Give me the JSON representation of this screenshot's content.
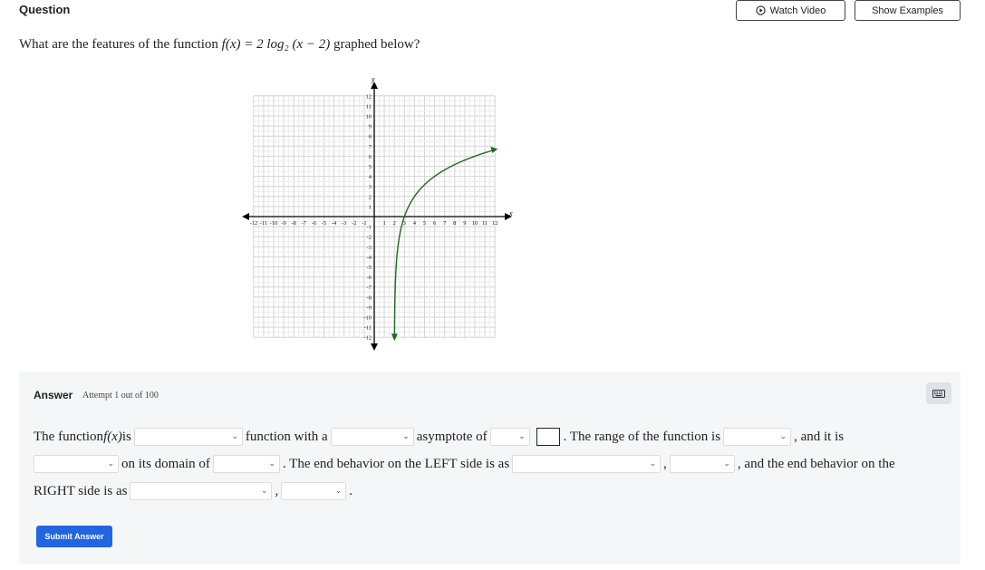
{
  "header": {
    "question_label": "Question",
    "watch_video": "Watch Video",
    "show_examples": "Show Examples"
  },
  "question": {
    "prefix": "What are the features of the function ",
    "function": "f(x) = 2 log₂ (x − 2)",
    "suffix": " graphed below?"
  },
  "graph": {
    "x_label": "x",
    "y_label": "y",
    "range": [
      -12,
      12
    ]
  },
  "answer": {
    "title": "Answer",
    "attempt": "Attempt 1 out of 100",
    "t1": "The function ",
    "fx": "f(x)",
    "t2": " is",
    "t3": "function with a",
    "t4": "asymptote of",
    "t5": ". The range of the function is",
    "t6": ", and it is",
    "t7": "on its domain of",
    "t8": ". The end behavior on the LEFT side is as",
    "t9": ",",
    "t10": ", and the end behavior on the",
    "t11": "RIGHT side is as",
    "t12": ",",
    "t13": ".",
    "submit": "Submit Answer"
  },
  "icons": {
    "play": "play-circle-icon",
    "keyboard": "keyboard-icon",
    "chevron": "chevron-down-icon"
  },
  "colors": {
    "curve": "#1e6b1e",
    "submit": "#2166e0",
    "panel": "#f5f6f7"
  }
}
